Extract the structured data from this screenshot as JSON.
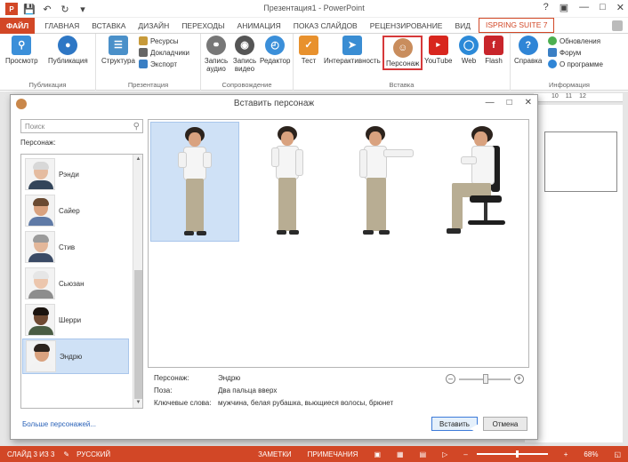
{
  "app": {
    "window_title": "Презентация1 - PowerPoint",
    "tabs": [
      "ФАЙЛ",
      "ГЛАВНАЯ",
      "ВСТАВКА",
      "ДИЗАЙН",
      "ПЕРЕХОДЫ",
      "АНИМАЦИЯ",
      "ПОКАЗ СЛАЙДОВ",
      "РЕЦЕНЗИРОВАНИЕ",
      "ВИД",
      "ISPRING SUITE 7"
    ]
  },
  "ribbon": {
    "publish_group": {
      "label": "Публикация",
      "preview": "Просмотр",
      "publish": "Публикация"
    },
    "presentation_group": {
      "label": "Презентация",
      "structure": "Структура",
      "resources": "Ресурсы",
      "speakers": "Докладчики",
      "export": "Экспорт"
    },
    "narration_group": {
      "label": "Сопровождение",
      "record_audio": "Запись аудио",
      "record_video": "Запись видео",
      "editor": "Редактор"
    },
    "insert_group": {
      "label": "Вставка",
      "test": "Тест",
      "interactivity": "Интерактивность",
      "character": "Персонаж",
      "youtube": "YouTube",
      "web": "Web",
      "flash": "Flash"
    },
    "info_group": {
      "label": "Информация",
      "help": "Справка",
      "updates": "Обновления",
      "forum": "Форум",
      "about": "О программе"
    }
  },
  "ruler": {
    "marks": [
      "10",
      "11",
      "12"
    ]
  },
  "dialog": {
    "title": "Вставить персонаж",
    "search_placeholder": "Поиск",
    "characters_label": "Персонаж:",
    "characters": [
      {
        "name": "Рэнди"
      },
      {
        "name": "Сайер"
      },
      {
        "name": "Стив"
      },
      {
        "name": "Сьюзан"
      },
      {
        "name": "Шерри"
      },
      {
        "name": "Эндрю"
      }
    ],
    "selected_character": "Эндрю",
    "more_link": "Больше персонажей...",
    "info": {
      "character_label": "Персонаж:",
      "character_value": "Эндрю",
      "pose_label": "Поза:",
      "pose_value": "Два пальца вверх",
      "keywords_label": "Ключевые слова:",
      "keywords_value": "мужчина, белая рубашка, вьющиеся волосы, брюнет"
    },
    "insert_button": "Вставить",
    "cancel_button": "Отмена"
  },
  "statusbar": {
    "slide": "СЛАЙД 3 ИЗ 3",
    "language": "РУССКИЙ",
    "notes": "ЗАМЕТКИ",
    "comments": "ПРИМЕЧАНИЯ",
    "zoom": "68%"
  },
  "colors": {
    "accent": "#d24726",
    "selection": "#cfe1f6",
    "link": "#2a62b8"
  }
}
